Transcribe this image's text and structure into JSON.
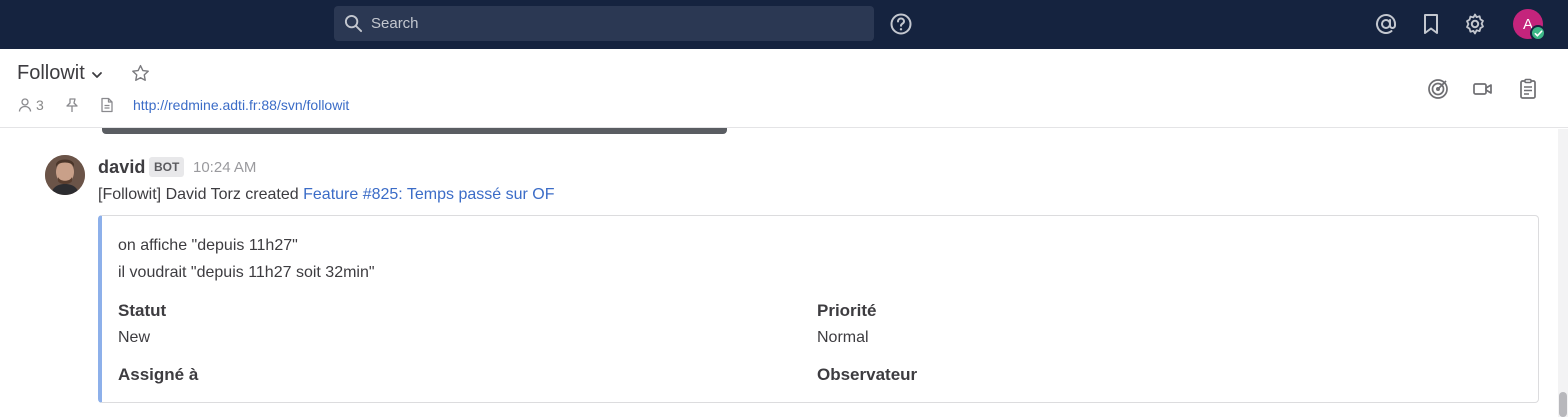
{
  "topbar": {
    "search_placeholder": "Search",
    "icons": [
      "search-icon",
      "help-icon",
      "at-mention-icon",
      "bookmark-icon",
      "gear-icon"
    ],
    "user_avatar_letter": "A",
    "user_avatar_color": "#c4247c",
    "user_status_color": "#3db887",
    "background_color": "#15233f"
  },
  "channel": {
    "name": "Followit",
    "member_count": "3",
    "header_url": "http://redmine.adti.fr:88/svn/followit",
    "right_icons": [
      "target-icon",
      "video-icon",
      "clipboard-icon"
    ]
  },
  "message": {
    "author": "david",
    "badge": "BOT",
    "time": "10:24 AM",
    "text_prefix": "[Followit] David Torz created ",
    "link_text": "Feature #825: Temps passé sur OF",
    "attachment": {
      "accent_color": "#8db0ea",
      "lines": [
        "on affiche \"depuis 11h27\"",
        "il voudrait \"depuis 11h27 soit 32min\""
      ],
      "fields": [
        {
          "title": "Statut",
          "value": "New"
        },
        {
          "title": "Priorité",
          "value": "Normal"
        },
        {
          "title": "Assigné à",
          "value": ""
        },
        {
          "title": "Observateur",
          "value": ""
        }
      ]
    }
  }
}
